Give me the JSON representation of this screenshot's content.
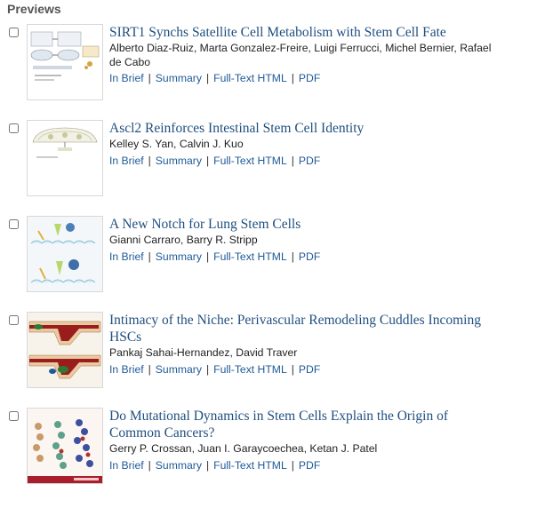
{
  "section_title": "Previews",
  "link_labels": {
    "in_brief": "In Brief",
    "summary": "Summary",
    "full_text": "Full-Text HTML",
    "pdf": "PDF",
    "separator": "|"
  },
  "articles": [
    {
      "title": "SIRT1 Synchs Satellite Cell Metabolism with Stem Cell Fate",
      "authors": "Alberto Diaz-Ruiz, Marta Gonzalez-Freire, Luigi Ferrucci, Michel Bernier, Rafael de Cabo"
    },
    {
      "title": "Ascl2 Reinforces Intestinal Stem Cell Identity",
      "authors": "Kelley S. Yan, Calvin J. Kuo"
    },
    {
      "title": "A New Notch for Lung Stem Cells",
      "authors": "Gianni Carraro, Barry R. Stripp"
    },
    {
      "title": "Intimacy of the Niche: Perivascular Remodeling Cuddles Incoming HSCs",
      "authors": "Pankaj Sahai-Hernandez, David Traver"
    },
    {
      "title": "Do Mutational Dynamics in Stem Cells Explain the Origin of Common Cancers?",
      "authors": "Gerry P. Crossan, Juan I. Garaycoechea, Ketan J. Patel"
    }
  ]
}
